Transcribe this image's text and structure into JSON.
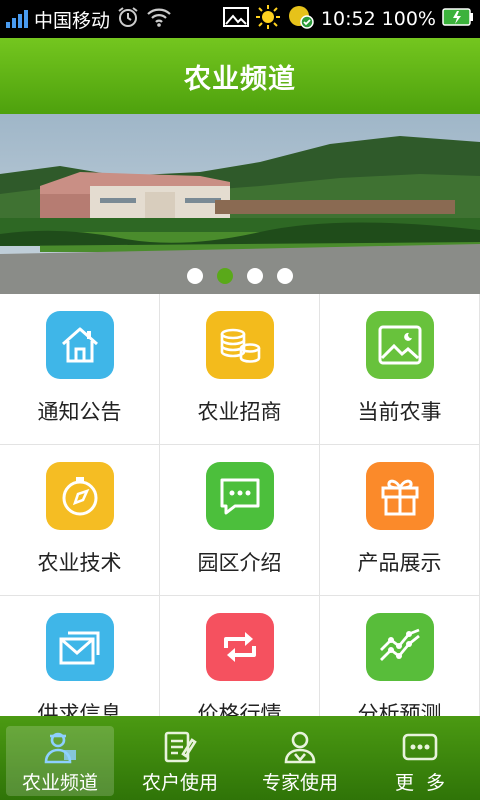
{
  "status_bar": {
    "carrier": "中国移动",
    "time": "10:52",
    "battery": "100%"
  },
  "header": {
    "title": "农业频道"
  },
  "banner": {
    "image": "park-building-photo",
    "slide_count": 4,
    "active_slide": 2
  },
  "grid": {
    "items": [
      {
        "label": "通知公告",
        "icon": "house-icon",
        "color": "#3fb6e8"
      },
      {
        "label": "农业招商",
        "icon": "coins-icon",
        "color": "#f3bb1c"
      },
      {
        "label": "当前农事",
        "icon": "picture-icon",
        "color": "#68c23c"
      },
      {
        "label": "农业技术",
        "icon": "compass-icon",
        "color": "#f5bd23"
      },
      {
        "label": "园区介绍",
        "icon": "chat-icon",
        "color": "#4cbf3c"
      },
      {
        "label": "产品展示",
        "icon": "gift-icon",
        "color": "#fb8a2a"
      },
      {
        "label": "供求信息",
        "icon": "mail-icon",
        "color": "#3fb6e8"
      },
      {
        "label": "价格行情",
        "icon": "refresh-icon",
        "color": "#f5515f"
      },
      {
        "label": "分析预测",
        "icon": "trend-icon",
        "color": "#58bd3a"
      }
    ]
  },
  "bottom_nav": {
    "items": [
      {
        "label": "农业频道",
        "icon": "farmer-icon"
      },
      {
        "label": "农户使用",
        "icon": "notepad-icon"
      },
      {
        "label": "专家使用",
        "icon": "expert-icon"
      },
      {
        "label": "更  多",
        "icon": "more-icon"
      }
    ],
    "active": 0
  }
}
